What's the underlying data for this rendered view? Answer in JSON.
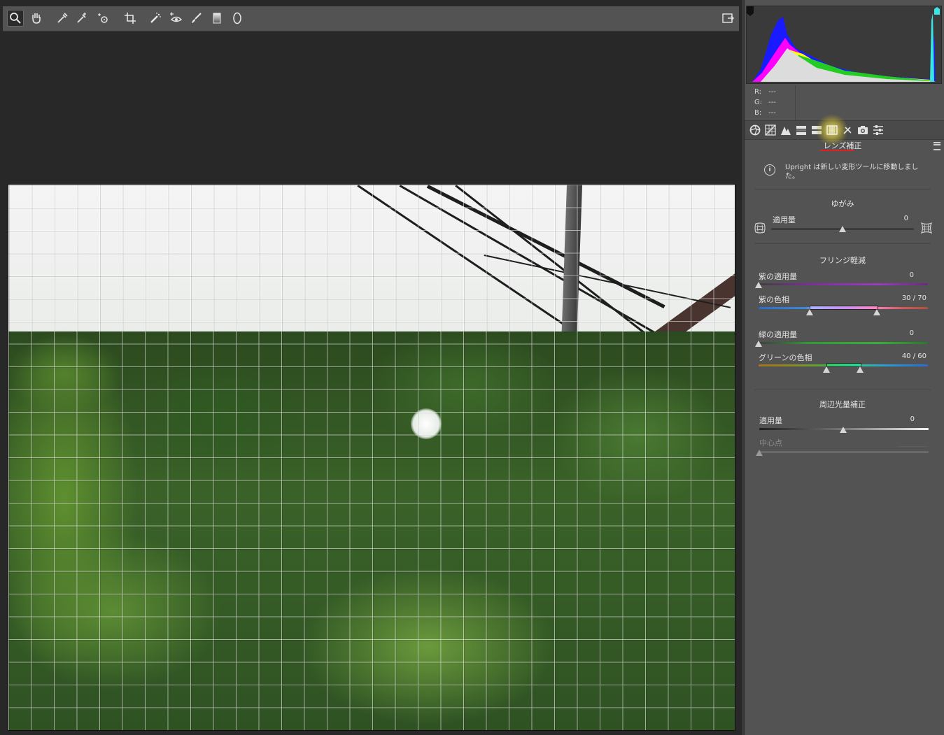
{
  "toolbar": {
    "tools": [
      "zoom-tool",
      "hand-tool",
      "white-balance-tool",
      "color-sampler-tool",
      "target-adjustment-tool",
      "crop-tool",
      "spot-removal-tool",
      "red-eye-tool",
      "adjustment-brush-tool",
      "graduated-filter-tool",
      "radial-filter-tool"
    ],
    "active_tool": "zoom-tool"
  },
  "readout": {
    "r_label": "R:",
    "r_value": "---",
    "g_label": "G:",
    "g_value": "---",
    "b_label": "B:",
    "b_value": "---"
  },
  "panel": {
    "tabs": [
      "basic",
      "tone-curve",
      "detail",
      "hsl",
      "split-toning",
      "lens-corrections",
      "effects",
      "camera-calibration",
      "presets"
    ],
    "active_tab": "lens-corrections",
    "title": "レンズ補正",
    "info_text": "Upright は新しい変形ツールに移動しました。",
    "distortion": {
      "section": "ゆがみ",
      "amount_label": "適用量",
      "amount_value": "0",
      "amount_position": 0.5
    },
    "defringe": {
      "section": "フリンジ軽減",
      "purple_amount_label": "紫の適用量",
      "purple_amount_value": "0",
      "purple_hue_label": "紫の色相",
      "purple_hue_value": "30 / 70",
      "green_amount_label": "緑の適用量",
      "green_amount_value": "0",
      "green_hue_label": "グリーンの色相",
      "green_hue_value": "40 / 60"
    },
    "vignetting": {
      "section": "周辺光量補正",
      "amount_label": "適用量",
      "amount_value": "0",
      "midpoint_label": "中心点",
      "midpoint_value": ""
    }
  },
  "colors": {
    "accent_underline": "#e32020",
    "panel_bg": "#535353",
    "canvas_bg": "#282828"
  }
}
